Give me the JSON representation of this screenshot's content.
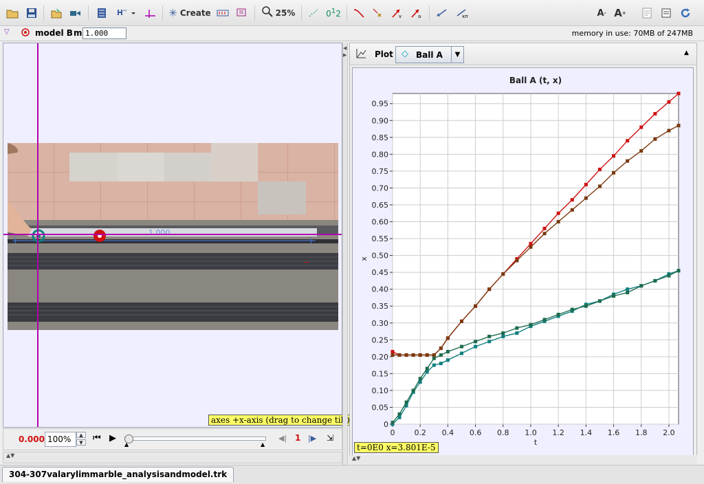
{
  "toolbar": {
    "create_label": "Create",
    "zoom_label": "25%",
    "icons": [
      "open-folder-icon",
      "save-disk-icon",
      "open-file-icon",
      "video-import-icon",
      "clip-settings-icon",
      "calibration-tools-icon",
      "axes-icon",
      "create-star-icon",
      "ruler-icon",
      "footprint-icon",
      "zoom-icon",
      "path-icon",
      "trace-icon",
      "trail-icon",
      "marker-icon",
      "velocity-icon",
      "acceleration-icon",
      "position-vector-icon",
      "mass-vector-icon",
      "font-increase-icon",
      "font-large-icon",
      "notes-icon",
      "info-icon",
      "refresh-icon"
    ]
  },
  "track_bar": {
    "track_name": "model B",
    "mass_label": "m",
    "mass_value": "1.000",
    "memory_text": "memory in use: 70MB of 247MB"
  },
  "video_view": {
    "calibration_value": "1.000",
    "axes_tooltip": "axes +x-axis (drag to change tilt)"
  },
  "playback": {
    "time": "0.000",
    "rate": "100%",
    "frame": "1",
    "progress": 0
  },
  "plot": {
    "view_label": "Plot",
    "selected_track": "Ball A",
    "readout": "t=0E0  x=3.801E-5"
  },
  "file_tab": "304-307valarylimmarble_analysisandmodel.trk",
  "colors": {
    "accent": "#b000b0",
    "ball_a": "#d01010",
    "model_b": "#7a3a10",
    "ball_b": "#108080",
    "model_c": "#1e6b4e",
    "selected_track": "#00a0c0"
  },
  "chart_data": {
    "type": "scatter",
    "title": "Ball A (t, x)",
    "xlabel": "t",
    "ylabel": "x",
    "xlim": [
      0,
      2.07
    ],
    "ylim": [
      0,
      0.98
    ],
    "xticks": [
      "0",
      "0.2",
      "0.4",
      "0.6",
      "0.8",
      "1.0",
      "1.2",
      "1.4",
      "1.6",
      "1.8",
      "2.0"
    ],
    "yticks": [
      "0",
      "0.05",
      "0.10",
      "0.15",
      "0.20",
      "0.25",
      "0.30",
      "0.35",
      "0.40",
      "0.45",
      "0.50",
      "0.55",
      "0.60",
      "0.65",
      "0.70",
      "0.75",
      "0.80",
      "0.85",
      "0.90",
      "0.95"
    ],
    "grid": true,
    "series": [
      {
        "color": "#d01010",
        "points": [
          [
            0,
            0.215
          ],
          [
            0.05,
            0.205
          ],
          [
            0.1,
            0.205
          ],
          [
            0.15,
            0.205
          ],
          [
            0.2,
            0.205
          ],
          [
            0.25,
            0.205
          ],
          [
            0.3,
            0.205
          ],
          [
            0.35,
            0.225
          ],
          [
            0.4,
            0.255
          ],
          [
            0.5,
            0.305
          ],
          [
            0.6,
            0.35
          ],
          [
            0.7,
            0.4
          ],
          [
            0.8,
            0.445
          ],
          [
            0.9,
            0.49
          ],
          [
            1.0,
            0.535
          ],
          [
            1.1,
            0.58
          ],
          [
            1.2,
            0.625
          ],
          [
            1.3,
            0.665
          ],
          [
            1.4,
            0.71
          ],
          [
            1.5,
            0.755
          ],
          [
            1.6,
            0.795
          ],
          [
            1.7,
            0.84
          ],
          [
            1.8,
            0.88
          ],
          [
            1.9,
            0.92
          ],
          [
            2.0,
            0.955
          ],
          [
            2.07,
            0.98
          ]
        ]
      },
      {
        "color": "#7a3a10",
        "points": [
          [
            0,
            0.205
          ],
          [
            0.05,
            0.205
          ],
          [
            0.1,
            0.205
          ],
          [
            0.15,
            0.205
          ],
          [
            0.2,
            0.205
          ],
          [
            0.25,
            0.205
          ],
          [
            0.3,
            0.205
          ],
          [
            0.35,
            0.225
          ],
          [
            0.4,
            0.255
          ],
          [
            0.5,
            0.305
          ],
          [
            0.6,
            0.35
          ],
          [
            0.7,
            0.4
          ],
          [
            0.8,
            0.445
          ],
          [
            0.9,
            0.485
          ],
          [
            1.0,
            0.525
          ],
          [
            1.1,
            0.565
          ],
          [
            1.2,
            0.6
          ],
          [
            1.3,
            0.635
          ],
          [
            1.4,
            0.67
          ],
          [
            1.5,
            0.705
          ],
          [
            1.6,
            0.745
          ],
          [
            1.7,
            0.78
          ],
          [
            1.8,
            0.81
          ],
          [
            1.9,
            0.845
          ],
          [
            2.0,
            0.87
          ],
          [
            2.07,
            0.885
          ]
        ]
      },
      {
        "color": "#108080",
        "points": [
          [
            0,
            0
          ],
          [
            0.05,
            0.02
          ],
          [
            0.1,
            0.055
          ],
          [
            0.15,
            0.095
          ],
          [
            0.2,
            0.125
          ],
          [
            0.25,
            0.155
          ],
          [
            0.3,
            0.175
          ],
          [
            0.35,
            0.18
          ],
          [
            0.4,
            0.19
          ],
          [
            0.5,
            0.21
          ],
          [
            0.6,
            0.23
          ],
          [
            0.7,
            0.245
          ],
          [
            0.8,
            0.26
          ],
          [
            0.9,
            0.27
          ],
          [
            1.0,
            0.29
          ],
          [
            1.1,
            0.305
          ],
          [
            1.2,
            0.32
          ],
          [
            1.3,
            0.335
          ],
          [
            1.4,
            0.355
          ],
          [
            1.5,
            0.365
          ],
          [
            1.6,
            0.385
          ],
          [
            1.7,
            0.4
          ],
          [
            1.8,
            0.41
          ],
          [
            1.9,
            0.425
          ],
          [
            2.0,
            0.445
          ],
          [
            2.07,
            0.455
          ]
        ]
      },
      {
        "color": "#1e6b4e",
        "points": [
          [
            0,
            0.005
          ],
          [
            0.05,
            0.03
          ],
          [
            0.1,
            0.065
          ],
          [
            0.15,
            0.1
          ],
          [
            0.2,
            0.135
          ],
          [
            0.25,
            0.165
          ],
          [
            0.3,
            0.195
          ],
          [
            0.35,
            0.205
          ],
          [
            0.4,
            0.215
          ],
          [
            0.5,
            0.23
          ],
          [
            0.6,
            0.245
          ],
          [
            0.7,
            0.26
          ],
          [
            0.8,
            0.27
          ],
          [
            0.9,
            0.285
          ],
          [
            1.0,
            0.295
          ],
          [
            1.1,
            0.31
          ],
          [
            1.2,
            0.325
          ],
          [
            1.3,
            0.34
          ],
          [
            1.4,
            0.35
          ],
          [
            1.5,
            0.365
          ],
          [
            1.6,
            0.38
          ],
          [
            1.7,
            0.39
          ],
          [
            1.8,
            0.41
          ],
          [
            1.9,
            0.425
          ],
          [
            2.0,
            0.44
          ],
          [
            2.07,
            0.455
          ]
        ]
      }
    ]
  }
}
